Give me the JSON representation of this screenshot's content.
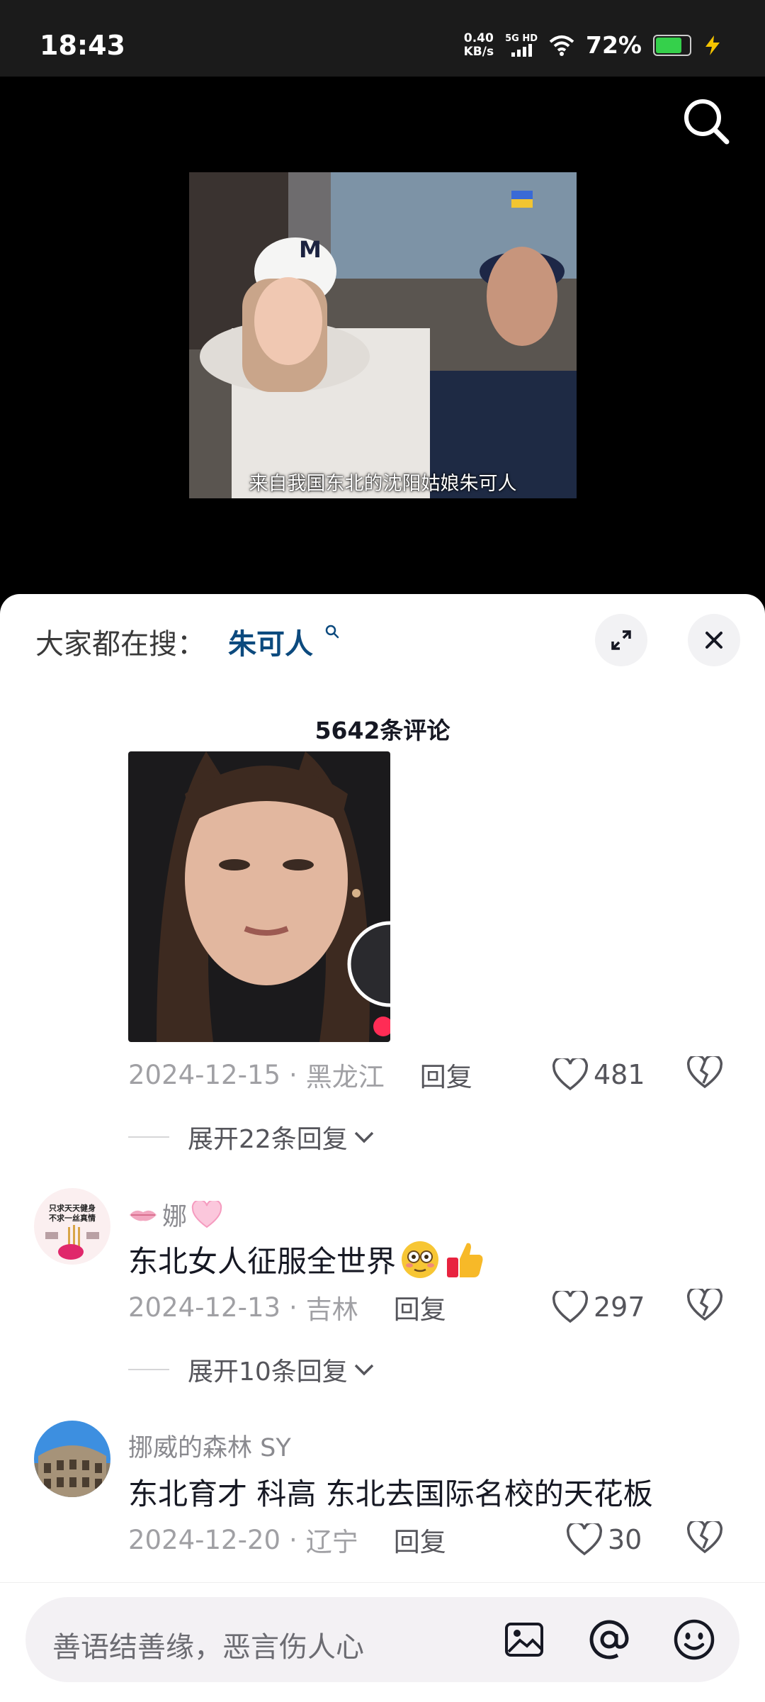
{
  "status": {
    "time": "18:43",
    "net_speed_value": "0.40",
    "net_speed_unit": "KB/s",
    "network_type": "5G HD",
    "battery_percent": "72%"
  },
  "video": {
    "subtitle": "来自我国东北的沈阳姑娘朱可人"
  },
  "panel": {
    "hot_search_prefix": "大家都在搜：",
    "hot_search_term": "朱可人",
    "comment_count": "5642条评论"
  },
  "comments": [
    {
      "date": "2024-12-15",
      "location": "黑龙江",
      "reply_label": "回复",
      "likes": "481",
      "expand_label": "展开22条回复"
    },
    {
      "username": "娜",
      "avatar_text_line1": "只求天天健身",
      "avatar_text_line2": "不求一丝真情",
      "text": "东北女人征服全世界",
      "date": "2024-12-13",
      "location": "吉林",
      "reply_label": "回复",
      "likes": "297",
      "expand_label": "展开10条回复"
    },
    {
      "username": "挪威的森林 SY",
      "text": "东北育才 科高 东北去国际名校的天花板",
      "date": "2024-12-20",
      "location": "辽宁",
      "reply_label": "回复",
      "likes": "30"
    }
  ],
  "input": {
    "placeholder": "善语结善缘，恶言伤人心"
  },
  "colors": {
    "hot_term": "#0c4a7e",
    "battery_fill": "#35d04b",
    "panel_bg": "#ffffff"
  }
}
